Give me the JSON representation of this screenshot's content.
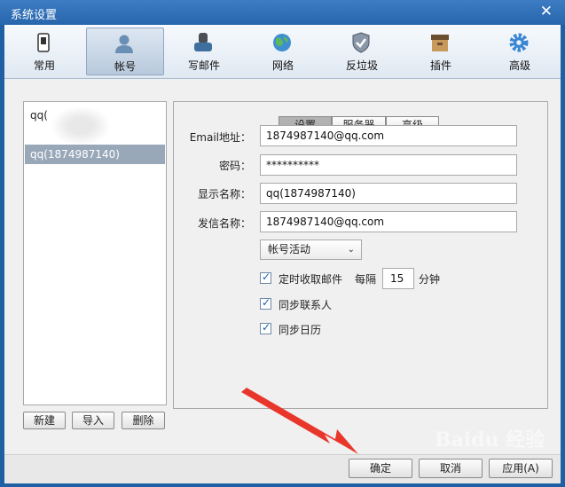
{
  "window": {
    "title": "系统设置",
    "close_icon": "✕"
  },
  "toolbar": {
    "items": [
      {
        "label": "常用",
        "icon": "window-icon"
      },
      {
        "label": "帐号",
        "icon": "user-icon"
      },
      {
        "label": "写邮件",
        "icon": "compose-icon"
      },
      {
        "label": "网络",
        "icon": "globe-icon"
      },
      {
        "label": "反垃圾",
        "icon": "shield-icon"
      },
      {
        "label": "插件",
        "icon": "box-icon"
      },
      {
        "label": "高级",
        "icon": "gear-icon"
      }
    ],
    "active_index": 1
  },
  "accounts": {
    "items": [
      "qq(",
      "qq(1874987140)"
    ],
    "selected_index": 1
  },
  "account_buttons": {
    "new": "新建",
    "import": "导入",
    "delete": "删除"
  },
  "tabs": {
    "items": [
      "设置",
      "服务器",
      "高级"
    ],
    "active_index": 0
  },
  "form": {
    "email_label": "Email地址：",
    "email_value": "1874987140@qq.com",
    "password_label": "密码：",
    "password_value": "**********",
    "display_name_label": "显示名称：",
    "display_name_value": "qq(1874987140)",
    "sender_name_label": "发信名称：",
    "sender_name_value": "1874987140@qq.com",
    "account_status": "帐号活动",
    "fetch_mail_label": "定时收取邮件",
    "fetch_mail_checked": true,
    "every_label": "每隔",
    "interval_value": "15",
    "minutes_label": "分钟",
    "sync_contacts_label": "同步联系人",
    "sync_contacts_checked": true,
    "sync_calendar_label": "同步日历",
    "sync_calendar_checked": true
  },
  "footer": {
    "ok": "确定",
    "cancel": "取消",
    "apply": "应用(A)"
  },
  "colors": {
    "titlebar": "#2766ad",
    "arrow": "#e8362b",
    "selected": "#99a8b9"
  },
  "watermark": "Baidu 经验"
}
